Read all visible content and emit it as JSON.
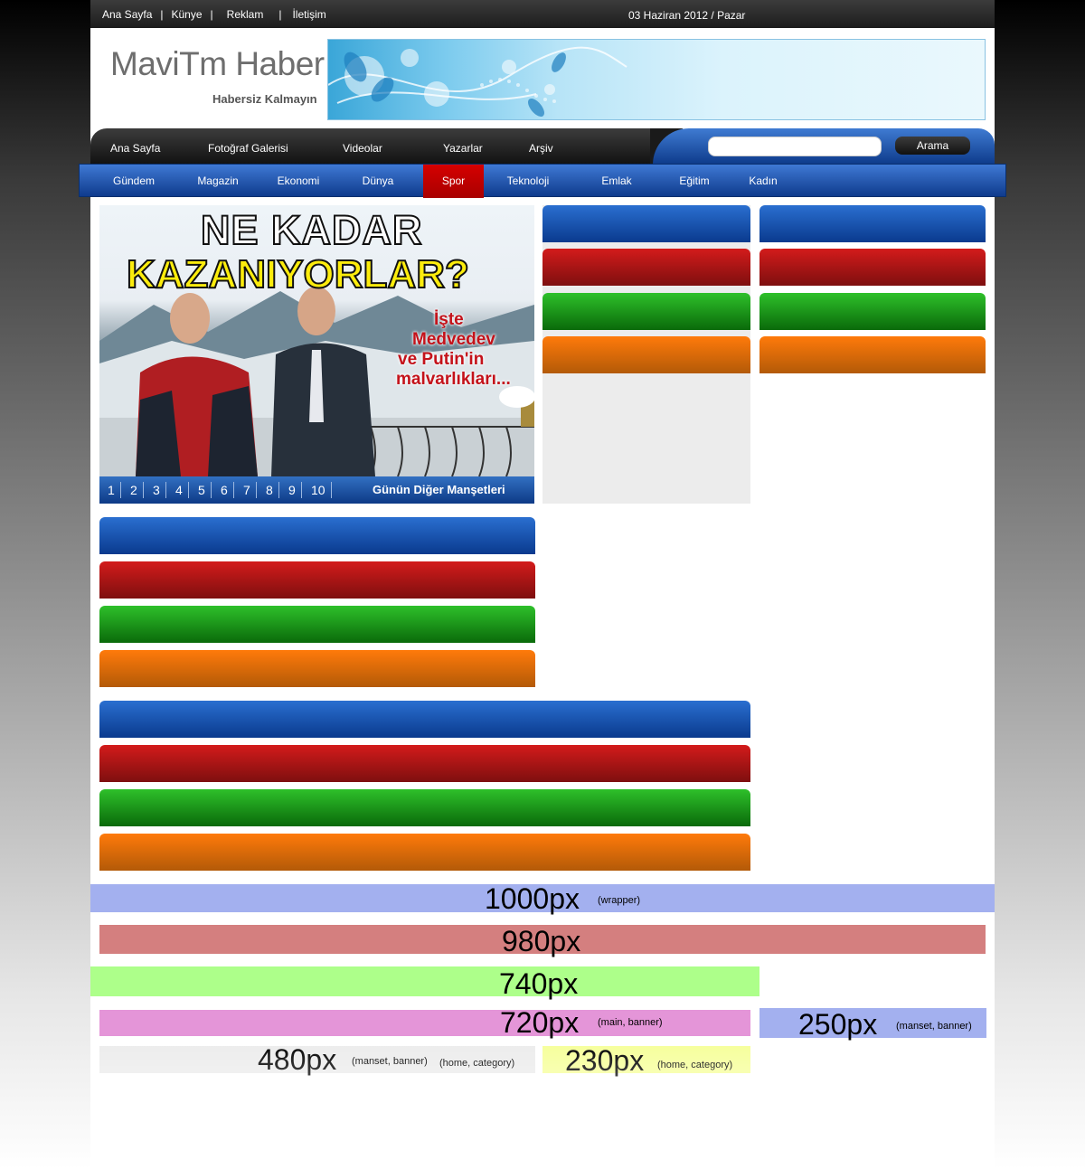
{
  "top_links": [
    "Ana Sayfa",
    "Künye",
    "Reklam",
    "İletişim"
  ],
  "separator": "|",
  "date_text": "03 Haziran 2012 / Pazar",
  "logo": "MaviTm Haber",
  "slogan": "Habersiz Kalmayın",
  "main_menu": [
    "Ana Sayfa",
    "Fotoğraf Galerisi",
    "Videolar",
    "Yazarlar",
    "Arşiv"
  ],
  "search": {
    "placeholder": "",
    "button": "Arama"
  },
  "category_menu": [
    "Gündem",
    "Magazin",
    "Ekonomi",
    "Dünya",
    "Spor",
    "Teknoloji",
    "Emlak",
    "Eğitim",
    "Kadın"
  ],
  "active_category": "Spor",
  "manset": {
    "headline_1": "NE KADAR",
    "headline_2": "KAZANIYORLAR?",
    "sub_1": "İşte",
    "sub_2": "Medvedev",
    "sub_3": "ve Putin'in",
    "sub_4": "malvarlıkları...",
    "pages": [
      "1",
      "2",
      "3",
      "4",
      "5",
      "6",
      "7",
      "8",
      "9",
      "10"
    ],
    "other_headlines": "Günün Diğer Manşetleri"
  },
  "box_colors": {
    "blue": "#0a3a8e",
    "red": "#7e0f0f",
    "green": "#0a6a0a",
    "orange": "#b35a08"
  },
  "legend": {
    "wrapper": {
      "size": "1000px",
      "note": "(wrapper)"
    },
    "l980": {
      "size": "980px"
    },
    "l740": {
      "size": "740px"
    },
    "l720": {
      "size": "720px",
      "note": "(main, banner)"
    },
    "l250": {
      "size": "250px",
      "note": "(manset, banner)"
    },
    "l480": {
      "size": "480px",
      "note1": "(manset, banner)",
      "note2": "(home, category)"
    },
    "l230": {
      "size": "230px",
      "note": "(home, category)"
    }
  },
  "legend_colors": {
    "wrapper": "#a3b0ef",
    "l980": "#d47f7f",
    "l740": "#adff8a",
    "l720": "#e495d8",
    "l250": "#a3b0ef",
    "l480": "#ececec",
    "l230": "#f6ff9a"
  }
}
